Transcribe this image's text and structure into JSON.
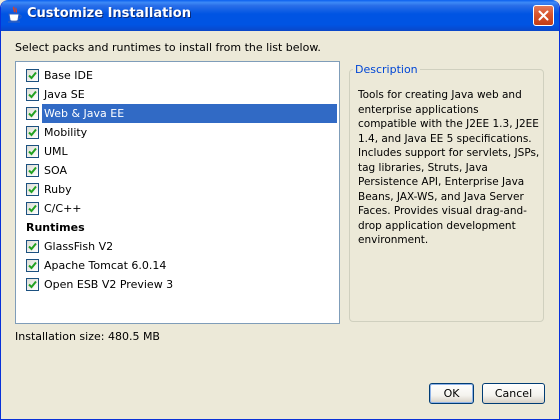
{
  "window": {
    "title": "Customize Installation"
  },
  "instructions": "Select packs and runtimes to install from the list below.",
  "packs": [
    {
      "label": "Base IDE",
      "checked": true,
      "selected": false
    },
    {
      "label": "Java SE",
      "checked": true,
      "selected": false
    },
    {
      "label": "Web & Java EE",
      "checked": true,
      "selected": true
    },
    {
      "label": "Mobility",
      "checked": true,
      "selected": false
    },
    {
      "label": "UML",
      "checked": true,
      "selected": false
    },
    {
      "label": "SOA",
      "checked": true,
      "selected": false
    },
    {
      "label": "Ruby",
      "checked": true,
      "selected": false
    },
    {
      "label": "C/C++",
      "checked": true,
      "selected": false
    }
  ],
  "runtimes_heading": "Runtimes",
  "runtimes": [
    {
      "label": "GlassFish V2",
      "checked": true
    },
    {
      "label": "Apache Tomcat 6.0.14",
      "checked": true
    },
    {
      "label": "Open ESB V2 Preview 3",
      "checked": true
    }
  ],
  "description": {
    "legend": "Description",
    "text": "Tools for creating Java web and enterprise applications compatible with the J2EE 1.3, J2EE 1.4, and Java EE 5 specifications. Includes support for servlets, JSPs, tag libraries, Struts, Java Persistence API, Enterprise Java Beans, JAX-WS, and Java Server Faces. Provides visual drag-and-drop application development environment."
  },
  "installation_size": "Installation size: 480.5 MB",
  "buttons": {
    "ok": "OK",
    "cancel": "Cancel"
  },
  "colors": {
    "titlebar": "#0054e3",
    "selection": "#316ac5",
    "legend": "#0046d5",
    "checkmark": "#21a121"
  },
  "icons": {
    "title": "java-coffee-cup-icon",
    "close": "close-x-icon",
    "check": "checkmark-icon"
  }
}
